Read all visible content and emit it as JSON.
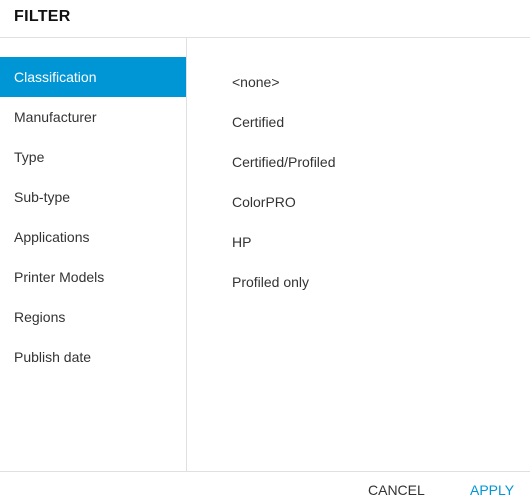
{
  "dialog": {
    "title": "FILTER"
  },
  "sidebar": {
    "active_index": 0,
    "items": [
      {
        "label": "Classification"
      },
      {
        "label": "Manufacturer"
      },
      {
        "label": "Type"
      },
      {
        "label": "Sub-type"
      },
      {
        "label": "Applications"
      },
      {
        "label": "Printer Models"
      },
      {
        "label": "Regions"
      },
      {
        "label": "Publish date"
      }
    ]
  },
  "options": {
    "items": [
      {
        "label": "<none>"
      },
      {
        "label": "Certified"
      },
      {
        "label": "Certified/Profiled"
      },
      {
        "label": "ColorPRO"
      },
      {
        "label": "HP"
      },
      {
        "label": "Profiled only"
      }
    ]
  },
  "footer": {
    "cancel_label": "CANCEL",
    "apply_label": "APPLY"
  },
  "colors": {
    "accent": "#0096d6",
    "divider": "#e0e0e0",
    "text": "#333333"
  }
}
